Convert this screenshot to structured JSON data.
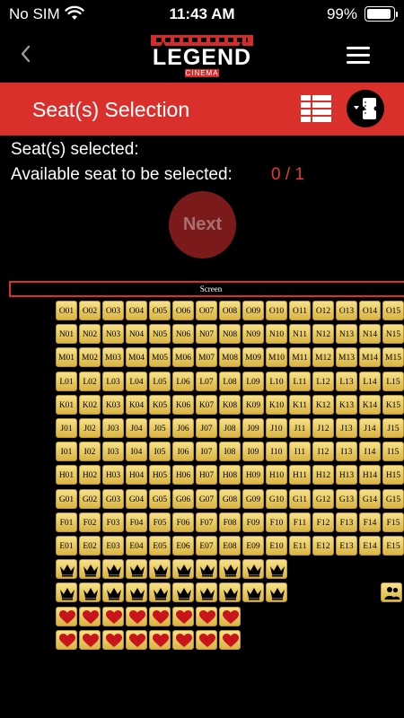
{
  "status": {
    "carrier": "No SIM",
    "time": "11:43 AM",
    "battery": "99%",
    "battery_level": 0.99
  },
  "nav": {
    "back_icon": "chevron-left-icon",
    "logo": "LEGEND",
    "logo_sub": "CINEMA",
    "menu_icon": "hamburger-menu-icon"
  },
  "header": {
    "title": "Seat(s) Selection",
    "legend_icon": "seat-legend-icon",
    "ticket_icon": "ticket-dropdown-icon"
  },
  "info": {
    "selected_label": "Seat(s) selected:",
    "available_label": "Available seat to be selected:",
    "available_count": "0 / 1"
  },
  "next_label": "Next",
  "screen_label": "Screen",
  "seat_rows": [
    {
      "row": "O",
      "first": 1,
      "last": 15
    },
    {
      "row": "N",
      "first": 1,
      "last": 15
    },
    {
      "row": "M",
      "first": 1,
      "last": 15
    },
    {
      "row": "L",
      "first": 1,
      "last": 15
    },
    {
      "row": "K",
      "first": 1,
      "last": 15
    },
    {
      "row": "J",
      "first": 1,
      "last": 15
    },
    {
      "row": "I",
      "first": 1,
      "last": 15
    },
    {
      "row": "H",
      "first": 1,
      "last": 15
    },
    {
      "row": "G",
      "first": 1,
      "last": 15
    },
    {
      "row": "F",
      "first": 1,
      "last": 15
    },
    {
      "row": "E",
      "first": 1,
      "last": 15
    }
  ],
  "special_rows": [
    {
      "kind": "crown",
      "count": 10
    },
    {
      "kind": "crown",
      "count": 10
    },
    {
      "kind": "heart",
      "count": 8
    },
    {
      "kind": "heart",
      "count": 8
    }
  ],
  "extra_seat_icon": "family-seat-icon",
  "colors": {
    "accent": "#d9302c",
    "seat": "#e8c862",
    "count": "#e53b30",
    "next_bg": "#7a1a1b"
  }
}
